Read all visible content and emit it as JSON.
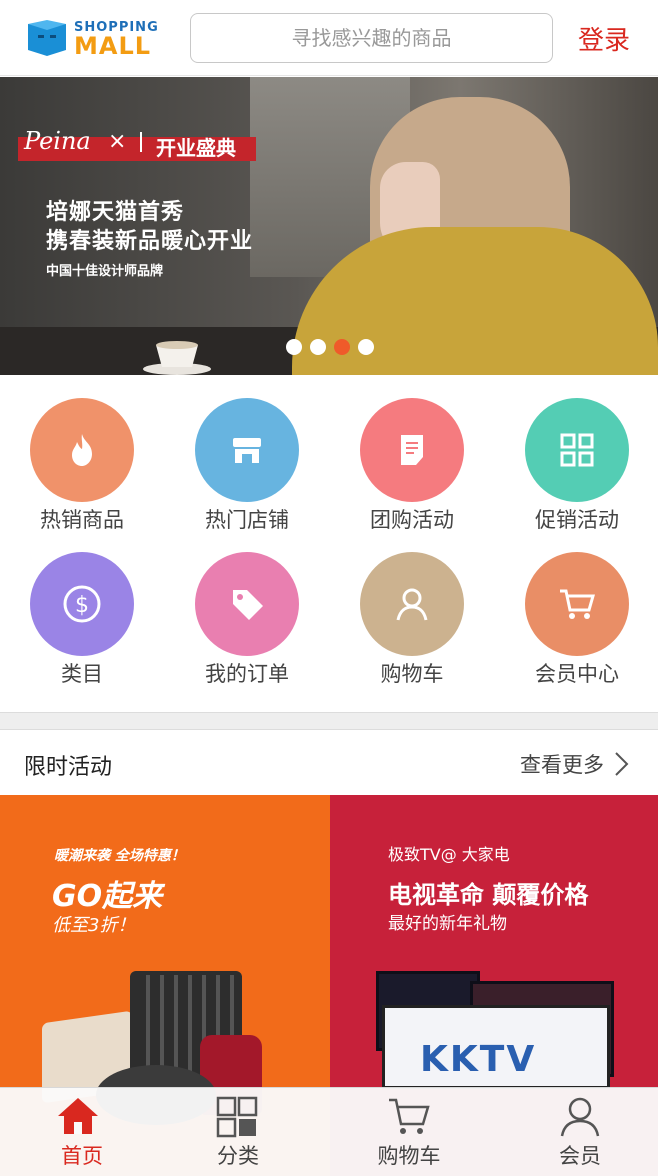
{
  "header": {
    "logo_line1": "SHOPPING",
    "logo_line2": "MALL",
    "search_placeholder": "寻找感兴趣的商品",
    "login_label": "登录"
  },
  "banner": {
    "brand_script": "Peina",
    "brand_x": "×",
    "brand_title": "开业盛典",
    "headline1": "培娜天猫首秀",
    "headline2": "携春装新品暖心开业",
    "subline": "中国十佳设计师品牌",
    "dots_count": 4,
    "active_dot": 3
  },
  "categories": [
    {
      "label": "热销商品",
      "icon": "fire-icon",
      "color": "#f0926a"
    },
    {
      "label": "热门店铺",
      "icon": "store-icon",
      "color": "#67b4e0"
    },
    {
      "label": "团购活动",
      "icon": "document-icon",
      "color": "#f57b7f"
    },
    {
      "label": "促销活动",
      "icon": "grid-icon",
      "color": "#54cdb4"
    },
    {
      "label": "类目",
      "icon": "dollar-icon",
      "color": "#9a84e6"
    },
    {
      "label": "我的订单",
      "icon": "tag-icon",
      "color": "#e97fb0"
    },
    {
      "label": "购物车",
      "icon": "user-icon",
      "color": "#ccb28f"
    },
    {
      "label": "会员中心",
      "icon": "cart-icon",
      "color": "#e98e66"
    }
  ],
  "flash_sale": {
    "title": "限时活动",
    "more_label": "查看更多"
  },
  "promos": {
    "left": {
      "line1": "暖潮来袭 全场特惠！",
      "line2": "GO起来",
      "line3": "低至3折！"
    },
    "right": {
      "line1": "极致TV@ 大家电",
      "line2": "电视革命 颠覆价格",
      "line3": "最好的新年礼物",
      "logo": "KKTV"
    }
  },
  "tabbar": [
    {
      "label": "首页",
      "icon": "home-icon",
      "active": true
    },
    {
      "label": "分类",
      "icon": "category-grid-icon",
      "active": false
    },
    {
      "label": "购物车",
      "icon": "cart-icon",
      "active": false
    },
    {
      "label": "会员",
      "icon": "user-icon",
      "active": false
    }
  ],
  "colors": {
    "accent": "#d9281f",
    "active_dot": "#ef5a2a",
    "promo_left_bg": "#f26b1a",
    "promo_right_bg": "#c7213a"
  }
}
